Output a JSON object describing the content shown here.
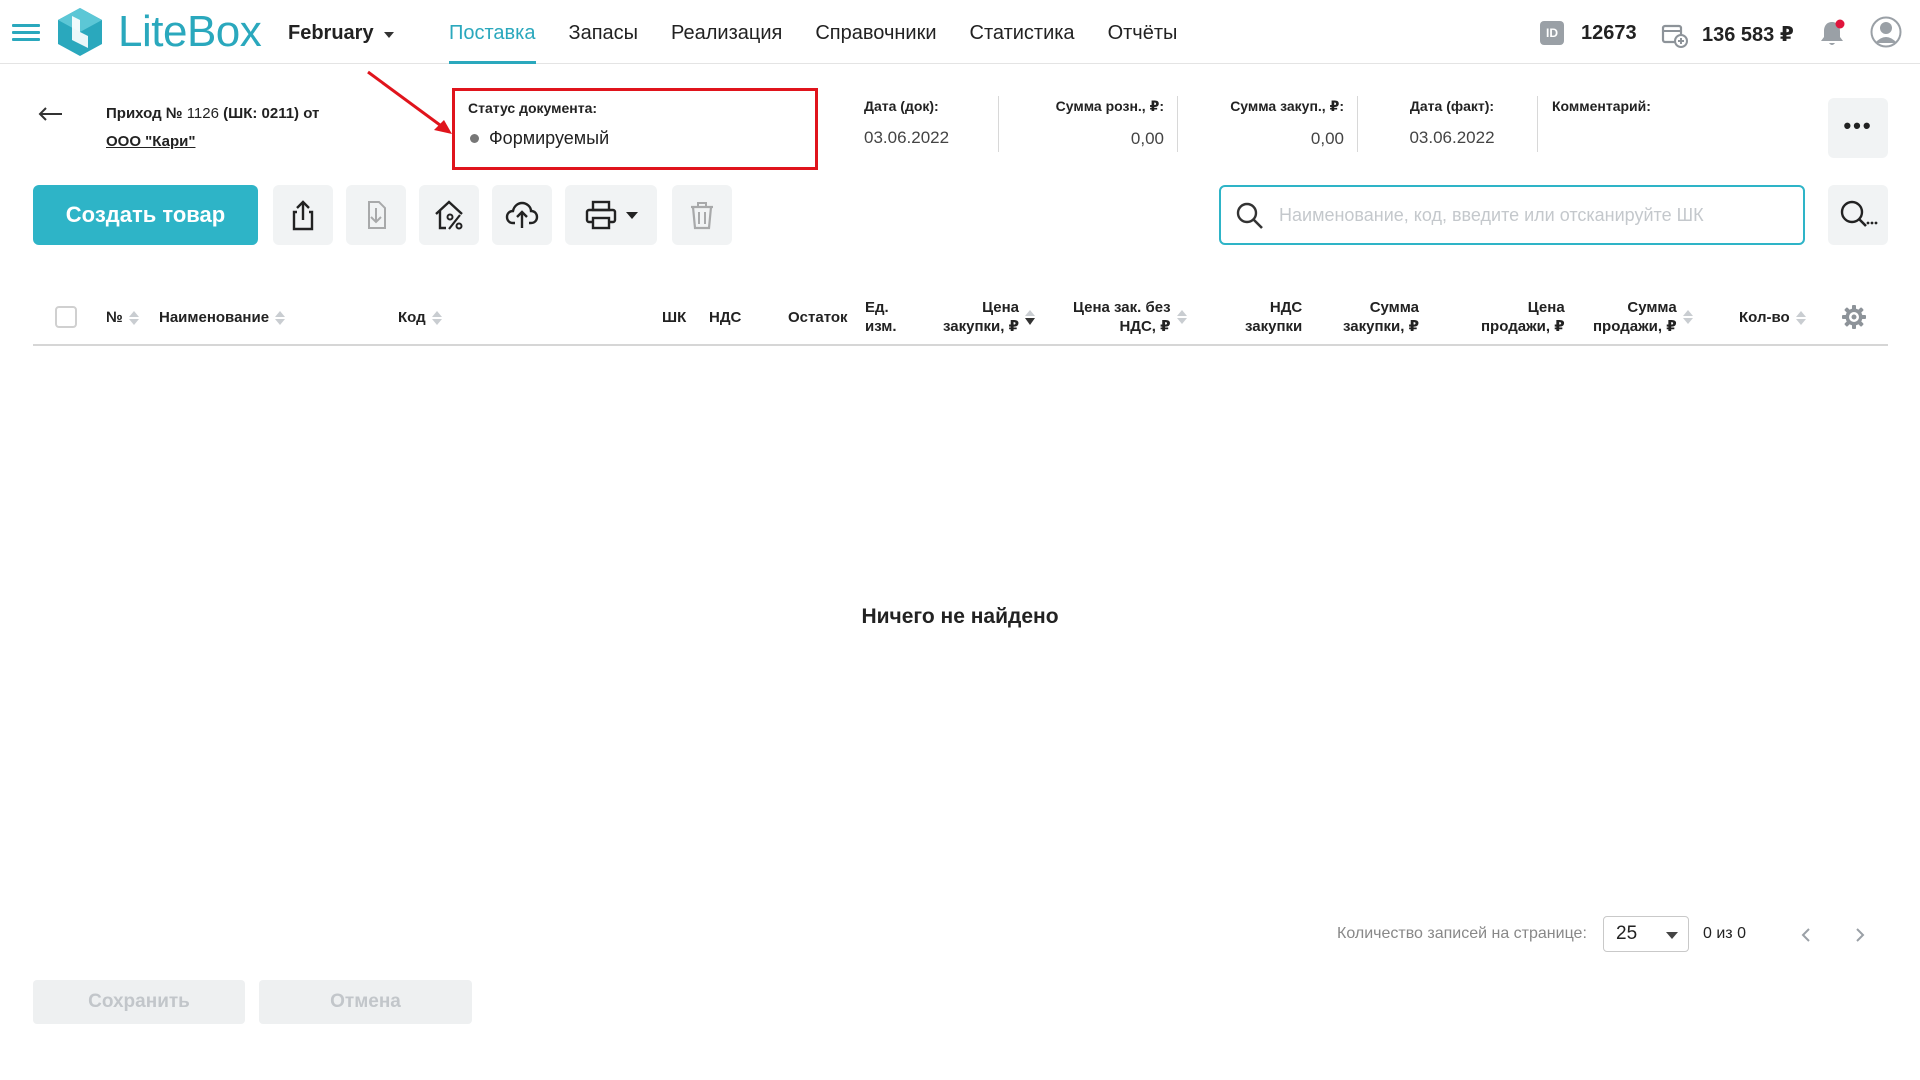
{
  "app": {
    "logo_text": "LiteBox",
    "accent": "#2aa8bd"
  },
  "org": {
    "name": "February"
  },
  "nav": {
    "items": [
      {
        "label": "Поставка",
        "active": true
      },
      {
        "label": "Запасы"
      },
      {
        "label": "Реализация"
      },
      {
        "label": "Справочники"
      },
      {
        "label": "Статистика"
      },
      {
        "label": "Отчёты"
      }
    ]
  },
  "account": {
    "id_badge": "ID",
    "id": "12673",
    "balance": "136 583 ₽"
  },
  "document": {
    "title_prefix": "Приход № ",
    "number": "1126",
    "barcode_part": " (ШК: 0211) от",
    "supplier": "ООО \"Кари\"",
    "status_label": "Статус документа:",
    "status_value": "Формируемый",
    "date_doc_label": "Дата (док):",
    "date_doc": "03.06.2022",
    "sum_retail_label": "Сумма розн., ₽:",
    "sum_retail": "0,00",
    "sum_purchase_label": "Сумма закуп., ₽:",
    "sum_purchase": "0,00",
    "date_fact_label": "Дата (факт):",
    "date_fact": "03.06.2022",
    "comment_label": "Комментарий:",
    "more_label": "•••"
  },
  "toolbar": {
    "create_label": "Создать товар",
    "search_placeholder": "Наименование, код, введите или отсканируйте ШК"
  },
  "table": {
    "col_no": "№",
    "col_name": "Наименование",
    "col_code": "Код",
    "col_barcode": "ШК",
    "col_vat": "НДС",
    "col_stock": "Остаток",
    "col_unit_1": "Ед.",
    "col_unit_2": "изм.",
    "col_price_buy_1": "Цена",
    "col_price_buy_2": "закупки, ₽",
    "col_price_buy_novat_1": "Цена зак. без",
    "col_price_buy_novat_2": "НДС, ₽",
    "col_vat_buy_1": "НДС",
    "col_vat_buy_2": "закупки",
    "col_sum_buy_1": "Сумма",
    "col_sum_buy_2": "закупки, ₽",
    "col_price_sale_1": "Цена",
    "col_price_sale_2": "продажи, ₽",
    "col_sum_sale_1": "Сумма",
    "col_sum_sale_2": "продажи, ₽",
    "col_qty": "Кол-во",
    "empty": "Ничего не найдено"
  },
  "pagination": {
    "per_page_label": "Количество записей на странице:",
    "per_page": "25",
    "count": "0 из 0"
  },
  "footer": {
    "save_label": "Сохранить",
    "cancel_label": "Отмена"
  }
}
